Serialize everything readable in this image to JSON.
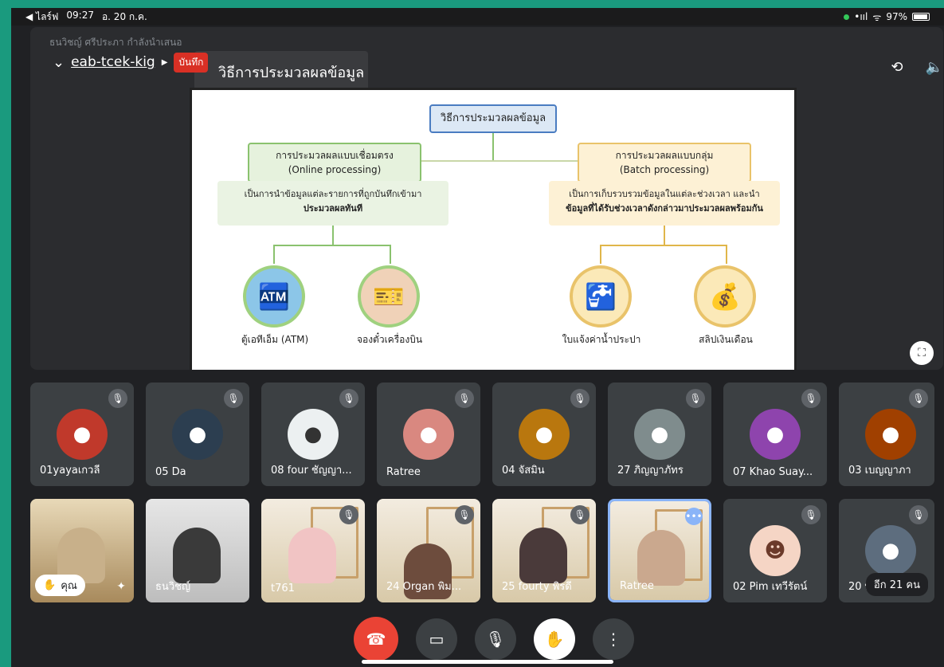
{
  "status_bar": {
    "back_app": "◀ ไลร์ฟ",
    "time": "09:27",
    "date": "อ. 20 ก.ค.",
    "signal": "•ııl",
    "wifi": "ᯤ",
    "battery": "97%"
  },
  "meeting": {
    "presenter_label": "ธนวิชญ์ ศรีประภา กำลังนำเสนอ",
    "code": "eab-tcek-kig",
    "record_badge": "บันทึก"
  },
  "slide": {
    "tab_title": "วิธีการประมวลผลข้อมูล",
    "root": "วิธีการประมวลผลข้อมูล",
    "online_title": "การประมวลผลแบบเชื่อมตรง",
    "online_en": "(Online processing)",
    "online_desc_1": "เป็นการนำข้อมูลแต่ละรายการที่ถูกบันทึกเข้ามา",
    "online_desc_2": "ประมวลผลทันที",
    "batch_title": "การประมวลผลแบบกลุ่ม",
    "batch_en": "(Batch processing)",
    "batch_desc_1": "เป็นการเก็บรวบรวมข้อมูลในแต่ละช่วงเวลา และนำ",
    "batch_desc_2": "ข้อมูลที่ได้รับช่วงเวลาดังกล่าวมาประมวลผลพร้อมกัน",
    "cap_atm": "ตู้เอทีเอ็ม (ATM)",
    "cap_ticket": "จองตั๋วเครื่องบิน",
    "cap_tap": "ใบแจ้งค่าน้ำประปา",
    "cap_slip": "สลิปเงินเดือน"
  },
  "participants_row1": [
    {
      "name": "01yayaเกวลี",
      "color": "#c0392b"
    },
    {
      "name": "05 Da",
      "color": "#2c3e50"
    },
    {
      "name": "08 four ชัญญา...",
      "color": "#ecf0f1"
    },
    {
      "name": "Ratree",
      "color": "#d98880"
    },
    {
      "name": "04 จัสมิน",
      "color": "#b9770e"
    },
    {
      "name": "27 ภิญญาภัทร",
      "color": "#7f8c8d"
    },
    {
      "name": "07 Khao Suay...",
      "color": "#8e44ad"
    },
    {
      "name": "03 เบญญาภา",
      "color": "#a04000"
    }
  ],
  "participants_row2": [
    {
      "name": "คุณ"
    },
    {
      "name": "ธนวิชญ์"
    },
    {
      "name": "t761"
    },
    {
      "name": "24 Organ พิม..."
    },
    {
      "name": "25 fourty พิรดี"
    },
    {
      "name": "Ratree"
    },
    {
      "name": "02 Pim เทวีรัตน์"
    },
    {
      "name": "20 พล"
    }
  ],
  "others_count": "อีก 21 คน",
  "icons": {
    "mute": "mic-off-icon",
    "camera": "camera-flip-icon",
    "speaker": "speaker-icon",
    "fullscreen": "fullscreen-icon",
    "hand": "raise-hand-icon",
    "end": "end-call-icon",
    "video": "video-icon",
    "mic": "mic-icon",
    "more": "more-vert-icon"
  }
}
